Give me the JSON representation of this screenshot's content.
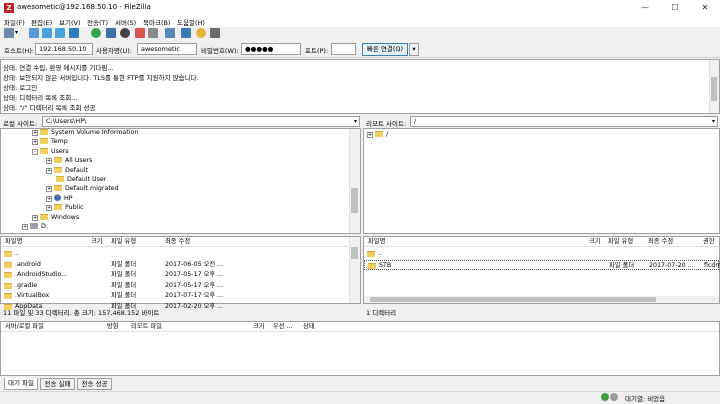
{
  "window": {
    "title": "awesometic@192.168.50.10 - FileZilla",
    "app_icon": "Z"
  },
  "menu": [
    "파일(F)",
    "편집(E)",
    "보기(V)",
    "전송(T)",
    "서버(S)",
    "북마크(B)",
    "도움말(H)"
  ],
  "toolbar_icons": [
    "site-manager-icon",
    "dropdown-icon",
    "toggle-log-icon",
    "toggle-local-tree-icon",
    "toggle-remote-tree-icon",
    "toggle-queue-icon",
    "refresh-icon",
    "process-queue-icon",
    "cancel-icon",
    "disconnect-icon",
    "reconnect-icon",
    "filter-icon",
    "compare-icon",
    "sync-browse-icon",
    "search-icon"
  ],
  "quickconnect": {
    "host_label": "호스트(H):",
    "host_value": "192.168.50.10",
    "user_label": "사용자명(U):",
    "user_value": "awesometic",
    "pass_label": "비밀번호(W):",
    "pass_value": "●●●●●",
    "port_label": "포트(P):",
    "port_value": "",
    "connect_label": "빠른 연결(Q)",
    "dropdown_label": "▾"
  },
  "log": [
    {
      "k": "상태:",
      "v": "연결 수립, 환영 메시지를 기다림..."
    },
    {
      "k": "상태:",
      "v": "보안되지 않은 서버입니다. TLS를 통한 FTP를 지원하지 않습니다."
    },
    {
      "k": "상태:",
      "v": "로그인"
    },
    {
      "k": "상태:",
      "v": "디렉터리 목록 조회..."
    },
    {
      "k": "상태:",
      "v": "\"/\" 디렉터리 목록 조회 성공"
    }
  ],
  "local": {
    "site_label": "로컬 사이트:",
    "path": "C:\\Users\\HP\\",
    "tree": [
      {
        "name": "System Volume Information",
        "indent": 1,
        "exp": "+"
      },
      {
        "name": "Temp",
        "indent": 1,
        "exp": "+"
      },
      {
        "name": "Users",
        "indent": 1,
        "exp": "-"
      },
      {
        "name": "All Users",
        "indent": 2,
        "exp": "+"
      },
      {
        "name": "Default",
        "indent": 2,
        "exp": "+"
      },
      {
        "name": "Default User",
        "indent": 2,
        "exp": ""
      },
      {
        "name": "Default.migrated",
        "indent": 2,
        "exp": "+"
      },
      {
        "name": "HP",
        "indent": 2,
        "exp": "+",
        "user": true
      },
      {
        "name": "Public",
        "indent": 2,
        "exp": "+"
      },
      {
        "name": "Windows",
        "indent": 1,
        "exp": "+"
      },
      {
        "name": "D:",
        "indent": 0,
        "exp": "+",
        "drive": true
      }
    ],
    "headers": [
      "파일명",
      "크기",
      "파일 유형",
      "최종 수정"
    ],
    "files": [
      {
        "name": "..",
        "size": "",
        "type": "",
        "modified": ""
      },
      {
        "name": ".android",
        "size": "",
        "type": "파일 폴더",
        "modified": "2017-06-05 오전 ..."
      },
      {
        "name": ".AndroidStudio...",
        "size": "",
        "type": "파일 폴더",
        "modified": "2017-05-17 오후 ..."
      },
      {
        "name": ".gradle",
        "size": "",
        "type": "파일 폴더",
        "modified": "2017-05-17 오후 ..."
      },
      {
        "name": ".VirtualBox",
        "size": "",
        "type": "파일 폴더",
        "modified": "2017-07-17 오후 ..."
      },
      {
        "name": "AppData",
        "size": "",
        "type": "파일 폴더",
        "modified": "2017-02-20 오후 ..."
      }
    ],
    "status": "11 파일 및 33 디렉터리. 총 크기: 157,468,152 바이트"
  },
  "remote": {
    "site_label": "리모트 사이트:",
    "path": "/",
    "tree": [
      {
        "name": "/",
        "exp": "+"
      }
    ],
    "headers": [
      "파일명",
      "크기",
      "파일 유형",
      "최종 수정",
      "권한"
    ],
    "files": [
      {
        "name": "..",
        "size": "",
        "type": "",
        "modified": "",
        "perm": ""
      },
      {
        "name": "STB",
        "size": "",
        "type": "파일 폴더",
        "modified": "2017-07-20 ...",
        "perm": "flcdm"
      }
    ],
    "status": "1 디렉터리"
  },
  "queue": {
    "headers": [
      "서버/로컬 파일",
      "방향",
      "리모트 파일",
      "크기",
      "우선 ...",
      "상태"
    ],
    "tabs": [
      "대기 파일",
      "전송 실패",
      "전송 성공"
    ],
    "status_text": "대기열: 비었음"
  }
}
